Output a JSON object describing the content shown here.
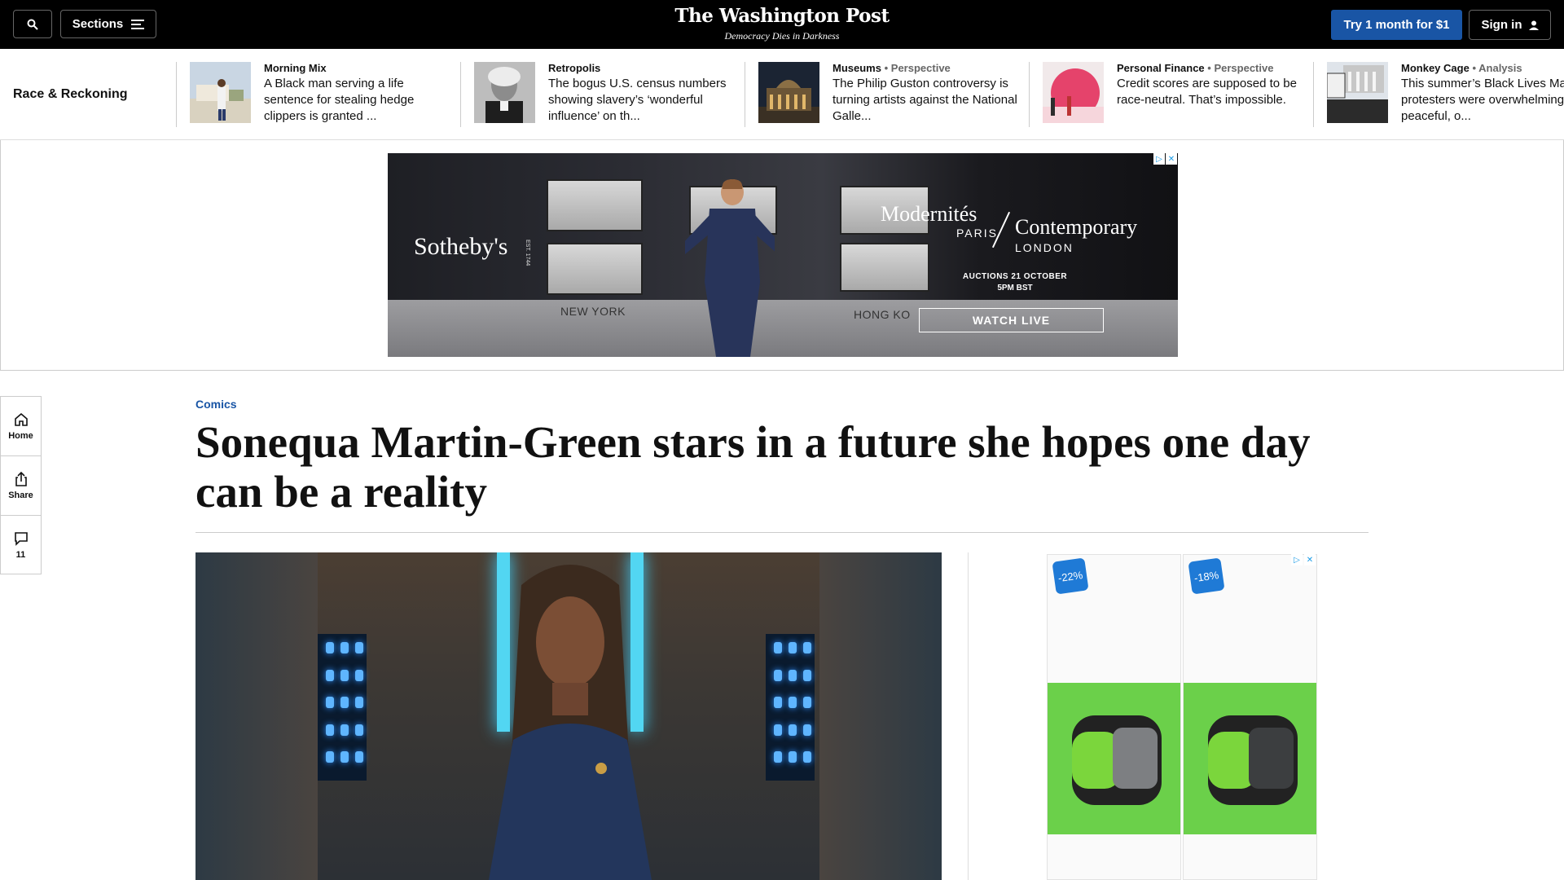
{
  "header": {
    "sections_label": "Sections",
    "logo": "The Washington Post",
    "tagline": "Democracy Dies in Darkness",
    "subscribe_label": "Try 1 month for $1",
    "signin_label": "Sign in"
  },
  "series": {
    "title": "Race & Reckoning",
    "items": [
      {
        "section": "Morning Mix",
        "label": "",
        "headline": "A Black man serving a life sentence for stealing hedge clippers is granted ..."
      },
      {
        "section": "Retropolis",
        "label": "",
        "headline": "The bogus U.S. census numbers showing slavery’s ‘wonderful influence’ on th..."
      },
      {
        "section": "Museums",
        "label": "Perspective",
        "headline": "The Philip Guston controversy is turning artists against the National Galle..."
      },
      {
        "section": "Personal Finance",
        "label": "Perspective",
        "headline": "Credit scores are supposed to be race-neutral. That’s impossible."
      },
      {
        "section": "Monkey Cage",
        "label": "Analysis",
        "headline": "This summer’s Black Lives Ma protesters were overwhelming peaceful, o..."
      }
    ]
  },
  "ad_banner": {
    "brand": "Sotheby's",
    "est": "EST. 1744",
    "city_left": "NEW YORK",
    "city_right": "HONG KO",
    "modernites": "Modernités",
    "paris": "PARIS",
    "contemporary": "Contemporary",
    "london": "LONDON",
    "auction_line1": "AUCTIONS 21 OCTOBER",
    "auction_line2": "5PM BST",
    "cta": "WATCH LIVE"
  },
  "rail": {
    "home_label": "Home",
    "share_label": "Share",
    "comments_count": "11"
  },
  "article": {
    "kicker": "Comics",
    "headline": "Sonequa Martin-Green stars in a future she hopes one day can be a reality"
  },
  "side_ad": {
    "discount_1": "-22%",
    "discount_2": "-18%"
  },
  "colors": {
    "accent": "#1955a5",
    "topbar": "#000000"
  }
}
